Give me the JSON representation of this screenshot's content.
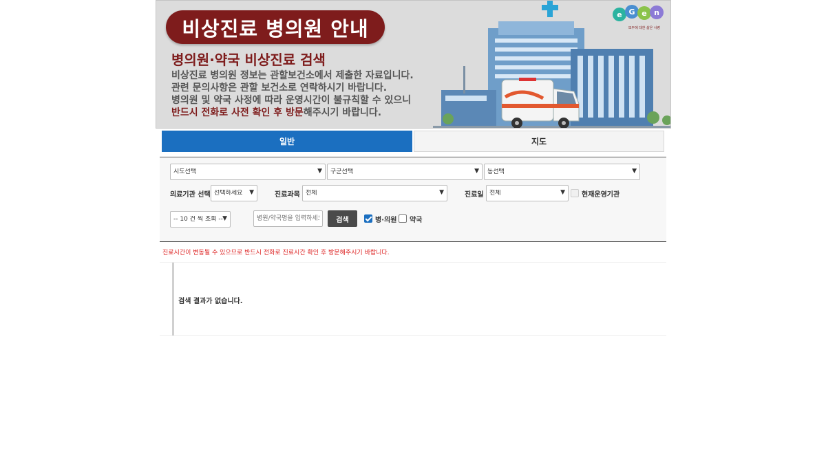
{
  "banner": {
    "title": "비상진료 병의원 안내",
    "subtitle": "병의원·약국 비상진료 검색",
    "lines": [
      "비상진료 병의원 정보는 관할보건소에서 제출한 자료입니다.",
      "관련 문의사항은 관할 보건소로 연락하시기 바랍니다.",
      "병의원 및 약국 사정에 따라 운영시간이 불규칙할 수 있으니"
    ],
    "last_line_strong": "반드시 전화로 사전 확인 후 방문",
    "last_line_rest": "해주시기 바랍니다.",
    "logo_caption": "모두에 대한 삶은 사랑",
    "colors": {
      "brand": "#7e1c1c",
      "accent": "#1b6fc0"
    }
  },
  "tabs": {
    "general": "일반",
    "map": "지도"
  },
  "search": {
    "sido": "시도선택",
    "gugun": "구군선택",
    "dong": "동선택",
    "institution_label": "의료기관 선택",
    "institution_value": "선택하세요",
    "department_label": "진료과목",
    "department_value": "전체",
    "day_label": "진료일",
    "day_value": "전체",
    "open_now_label": "현재운영기관",
    "page_size": "-- 10 건 씩 조회 --",
    "keyword_placeholder": "병원/약국명을 입력하세요",
    "search_button": "검색",
    "hospital_label": "병·의원",
    "pharmacy_label": "약국",
    "hospital_checked": true,
    "pharmacy_checked": false
  },
  "notice": "진료시간이 변동될 수 있으므로 반드시 전화로 진료시간 확인 후 방문해주시기 바랍니다.",
  "results": {
    "empty_message": "검색 결과가 없습니다."
  }
}
